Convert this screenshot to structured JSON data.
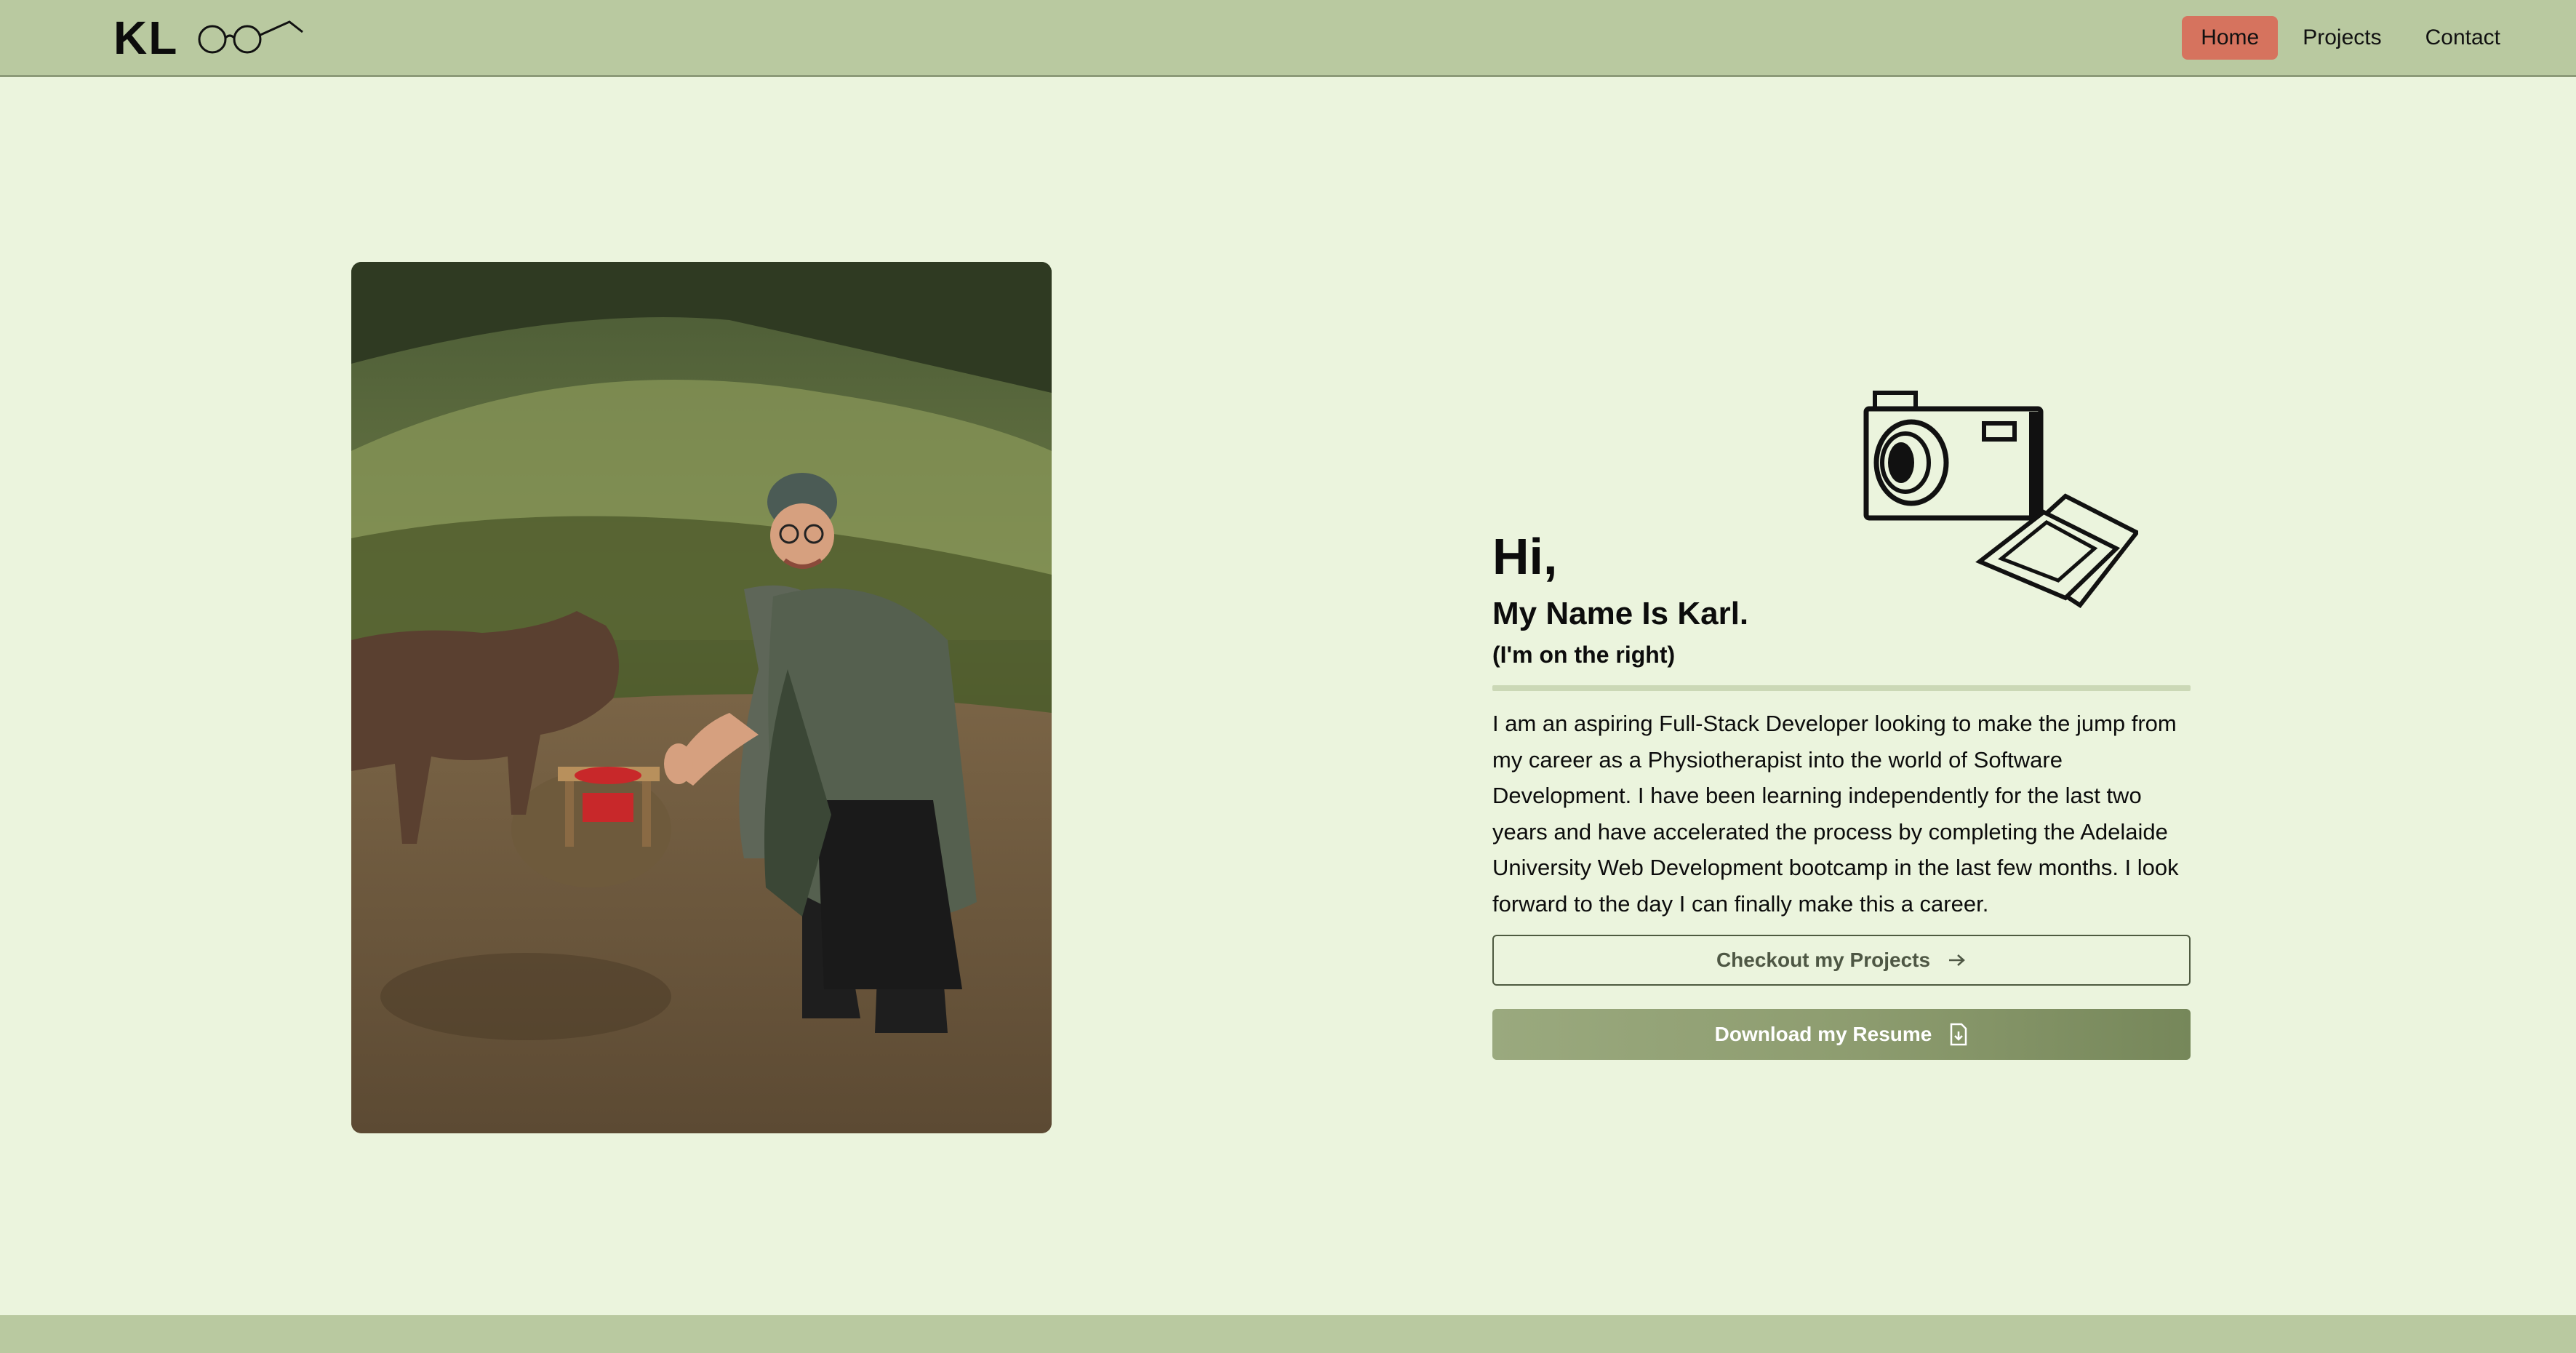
{
  "brand": {
    "logo_text": "KL",
    "logo_icon": "glasses-icon"
  },
  "nav": {
    "items": [
      {
        "label": "Home",
        "active": true
      },
      {
        "label": "Projects",
        "active": false
      },
      {
        "label": "Contact",
        "active": false
      }
    ]
  },
  "hero": {
    "greeting": "Hi,",
    "name": "My Name Is Karl.",
    "aside": "(I'm on the right)",
    "bio": "I am an aspiring Full-Stack Developer looking to make the jump from my career as a Physiotherapist into the world of Software Development. I have been learning independently for the last two years and have accelerated the process by completing the Adelaide University Web Development bootcamp in the last few months. I look forward to the day I can finally make this a career.",
    "illustration_icon": "camera-photos-icon",
    "projects_button": "Checkout my Projects",
    "projects_button_icon": "arrow-right-icon",
    "resume_button": "Download my Resume",
    "resume_button_icon": "file-download-icon"
  },
  "photo": {
    "subject": "portrait-photo"
  },
  "colors": {
    "background": "#ebf4dd",
    "navbar": "#b9c9a0",
    "active_nav": "#d6735e",
    "button_solid": "#8e9d70"
  }
}
